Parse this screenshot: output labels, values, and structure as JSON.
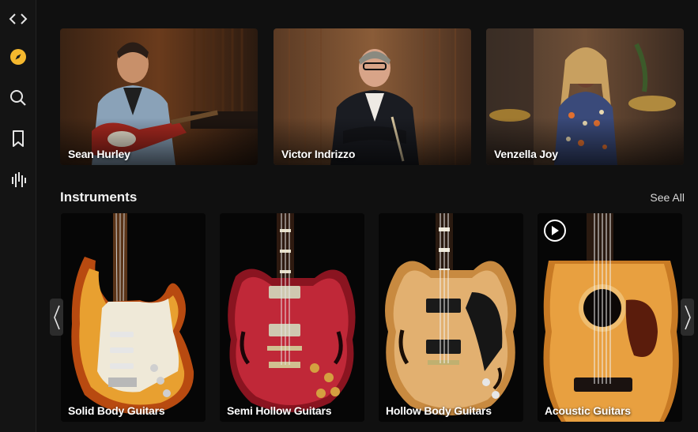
{
  "sidebar": {
    "items": [
      {
        "icon": "code-arrows-icon"
      },
      {
        "icon": "compass-icon",
        "active": true
      },
      {
        "icon": "search-icon"
      },
      {
        "icon": "bookmark-icon"
      },
      {
        "icon": "audio-bars-icon"
      }
    ],
    "accent_color": "#f5b82e"
  },
  "artists": [
    {
      "name": "Sean Hurley"
    },
    {
      "name": "Victor Indrizzo"
    },
    {
      "name": "Venzella Joy"
    }
  ],
  "instruments": {
    "title": "Instruments",
    "see_all": "See All",
    "items": [
      {
        "label": "Solid Body Guitars"
      },
      {
        "label": "Semi Hollow Guitars"
      },
      {
        "label": "Hollow Body Guitars"
      },
      {
        "label": "Acoustic Guitars",
        "has_play": true
      }
    ]
  }
}
